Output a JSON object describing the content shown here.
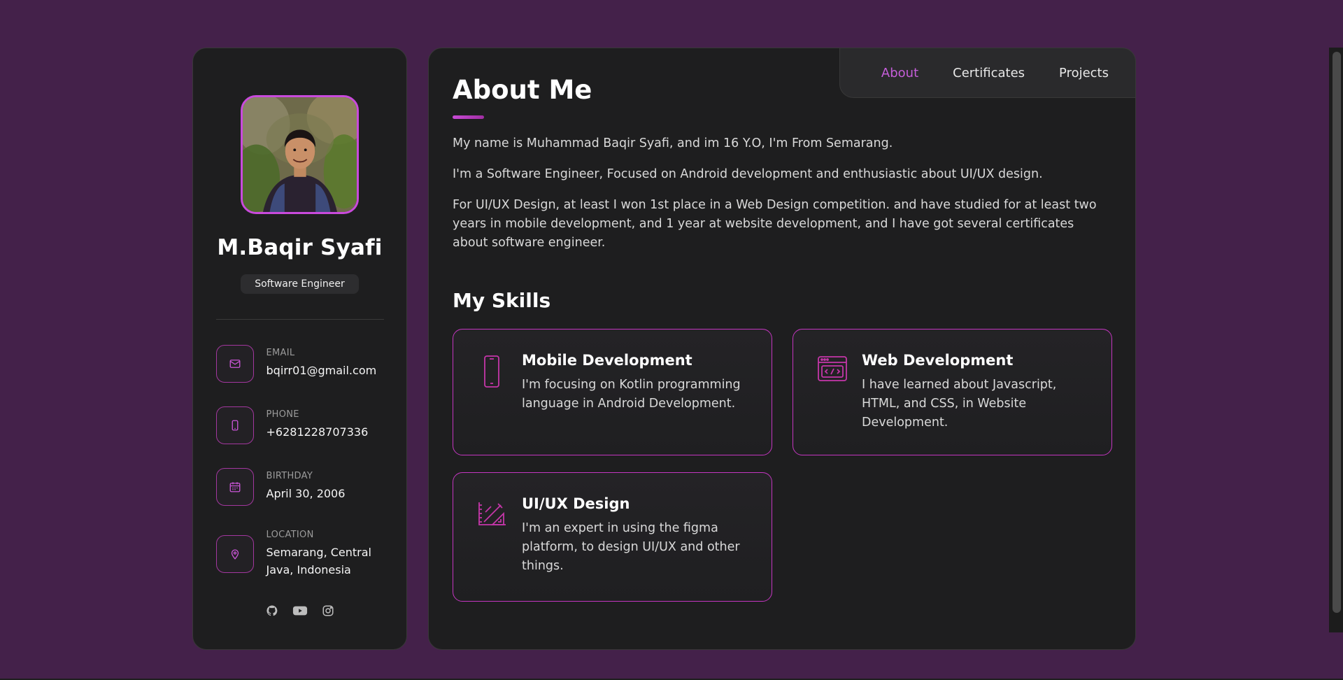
{
  "profile": {
    "name": "M.Baqir Syafi",
    "title": "Software Engineer"
  },
  "contacts": [
    {
      "icon": "mail-icon",
      "label": "EMAIL",
      "value": "bqirr01@gmail.com"
    },
    {
      "icon": "phone-icon",
      "label": "PHONE",
      "value": "+6281228707336"
    },
    {
      "icon": "calendar-icon",
      "label": "BIRTHDAY",
      "value": "April 30, 2006"
    },
    {
      "icon": "location-icon",
      "label": "LOCATION",
      "value": "Semarang, Central Java, Indonesia"
    }
  ],
  "socials": [
    "github-icon",
    "youtube-icon",
    "instagram-icon"
  ],
  "nav": {
    "items": [
      {
        "label": "About",
        "active": true
      },
      {
        "label": "Certificates",
        "active": false
      },
      {
        "label": "Projects",
        "active": false
      }
    ]
  },
  "about": {
    "title": "About Me",
    "paragraphs": [
      "My name is Muhammad Baqir Syafi, and im 16 Y.O, I'm From Semarang.",
      "I'm a Software Engineer, Focused on Android development and enthusiastic about UI/UX design.",
      "For UI/UX Design, at least I won 1st place in a Web Design competition. and have studied for at least two years in mobile development, and 1 year at website development, and I have got several certificates about software engineer."
    ]
  },
  "skills": {
    "title": "My Skills",
    "items": [
      {
        "icon": "smartphone-icon",
        "name": "Mobile Development",
        "description": "I'm focusing on Kotlin programming language in Android Development."
      },
      {
        "icon": "code-window-icon",
        "name": "Web Development",
        "description": "I have learned about Javascript, HTML, and CSS, in Website Development."
      },
      {
        "icon": "design-tools-icon",
        "name": "UI/UX Design",
        "description": "I'm an expert in using the figma platform, to design UI/UX and other things."
      }
    ]
  },
  "colors": {
    "background": "#44214a",
    "panel": "#1e1e1f",
    "accent": "#c55ed9",
    "card_border": "#c436c0"
  }
}
